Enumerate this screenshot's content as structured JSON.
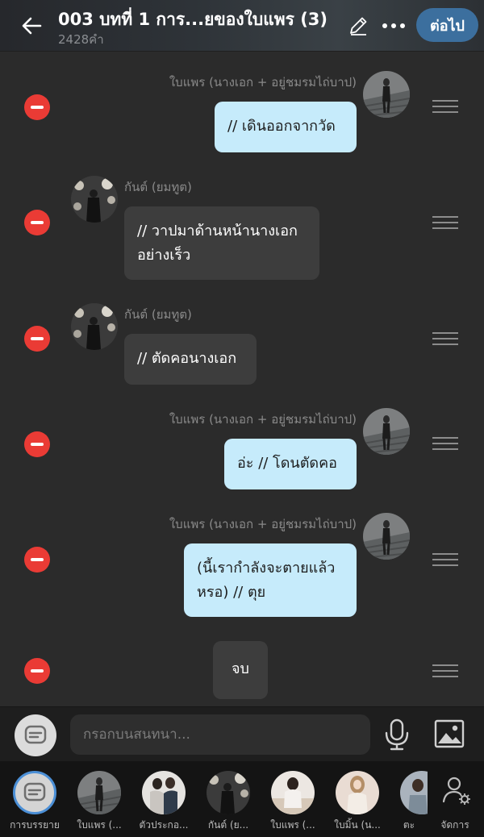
{
  "header": {
    "title": "003 บทที่ 1 การ...ยของใบแพร (3)",
    "word_count": "2428คำ",
    "next_label": "ต่อไป"
  },
  "messages": [
    {
      "side": "right",
      "sender": "ใบแพร (นางเอก + อยู่ชมรมไถ่บาป)",
      "text": "// เดินออกจากวัด",
      "avatar": "woman-stairs"
    },
    {
      "side": "left",
      "sender": "กันต์ (ยมทูต)",
      "text": "// วาปมาด้านหน้านางเอก อย่างเร็ว",
      "avatar": "man-bokeh"
    },
    {
      "side": "left",
      "sender": "กันต์ (ยมทูต)",
      "text": "// ตัดคอนางเอก",
      "avatar": "man-bokeh"
    },
    {
      "side": "right",
      "sender": "ใบแพร (นางเอก + อยู่ชมรมไถ่บาป)",
      "text": "อ่ะ // โดนตัดคอ",
      "avatar": "woman-stairs"
    },
    {
      "side": "right",
      "sender": "ใบแพร (นางเอก + อยู่ชมรมไถ่บาป)",
      "text": "(นี้เรากำลังจะตายแล้ว หรอ) // ตุย",
      "avatar": "woman-stairs"
    },
    {
      "side": "center",
      "text": "จบ"
    }
  ],
  "input": {
    "placeholder": "กรอกบนสนทนา..."
  },
  "characters": [
    {
      "label": "การบรรยาย",
      "icon": "narration-icon"
    },
    {
      "label": "ใบแพร (...",
      "avatar": "woman-stairs"
    },
    {
      "label": "ตัวประกอ...",
      "avatar": "couple"
    },
    {
      "label": "กันต์ (ย...",
      "avatar": "man-bokeh"
    },
    {
      "label": "ใบแพร (...",
      "avatar": "woman-room"
    },
    {
      "label": "ใบมิ้น (น...",
      "avatar": "woman-blonde"
    },
    {
      "label": "ตะ",
      "avatar": "partial"
    }
  ],
  "manage_label": "จัดการ",
  "colors": {
    "accent": "#3c6f9e",
    "delete": "#ea3b35",
    "bubble_self": "#c6ebfb",
    "bubble_other": "#3d3d3d"
  }
}
